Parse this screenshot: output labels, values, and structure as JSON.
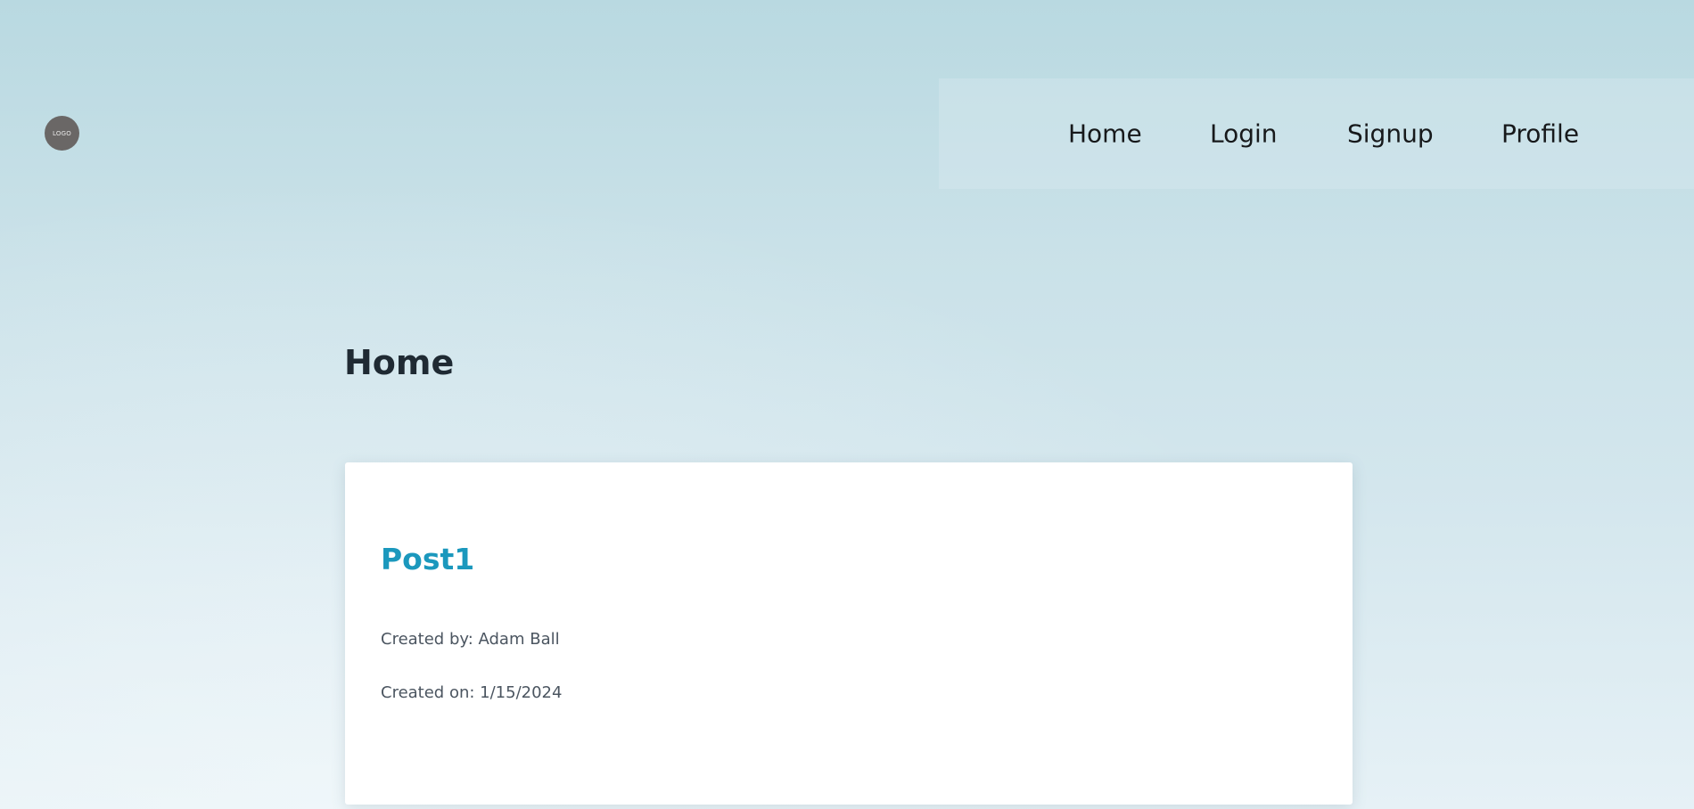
{
  "header": {
    "logo_text": "LOGO"
  },
  "nav": {
    "items": [
      {
        "label": "Home"
      },
      {
        "label": "Login"
      },
      {
        "label": "Signup"
      },
      {
        "label": "Profile"
      }
    ]
  },
  "main": {
    "title": "Home",
    "posts": [
      {
        "title": "Post1",
        "created_by": "Created by: Adam Ball",
        "created_on": "Created on: 1/15/2024"
      }
    ]
  },
  "colors": {
    "post_title": "#1b98bd",
    "logo_bg": "#6a6766",
    "heading": "#1f2a33"
  }
}
